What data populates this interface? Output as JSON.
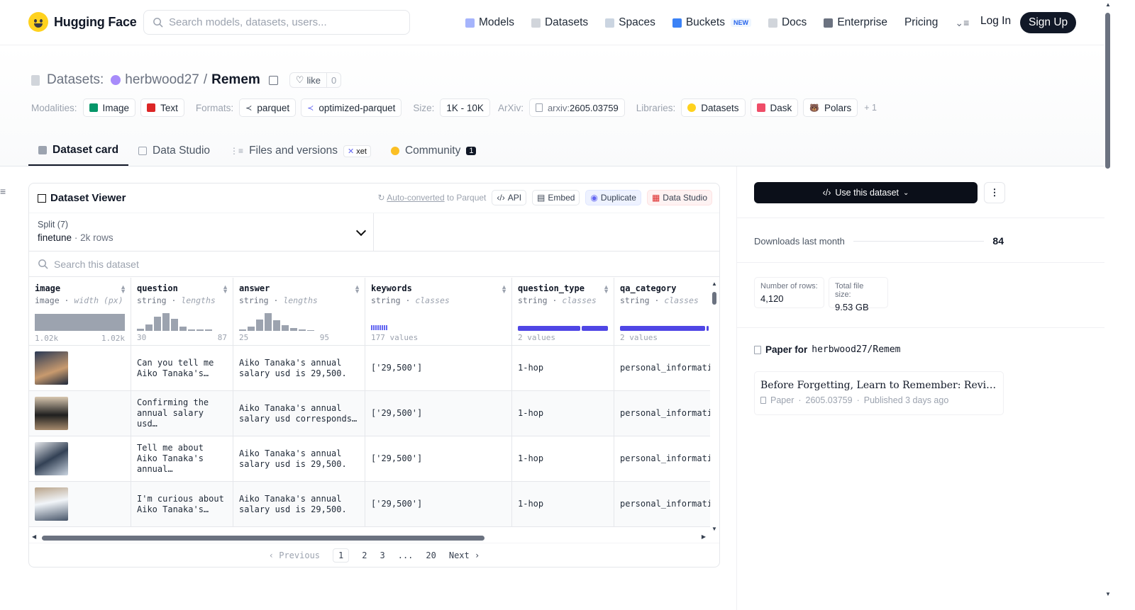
{
  "brand": {
    "name": "Hugging Face"
  },
  "search": {
    "placeholder": "Search models, datasets, users..."
  },
  "nav": {
    "items": [
      "Models",
      "Datasets",
      "Spaces",
      "Buckets",
      "Docs",
      "Enterprise",
      "Pricing"
    ],
    "new_badge": "NEW",
    "login": "Log In",
    "signup": "Sign Up"
  },
  "repo": {
    "type_label": "Datasets:",
    "owner": "herbwood27",
    "separator": "/",
    "name": "Remem",
    "like_label": "like",
    "like_count": "0"
  },
  "meta": {
    "modalities_label": "Modalities:",
    "modalities": [
      "Image",
      "Text"
    ],
    "formats_label": "Formats:",
    "formats": [
      "parquet",
      "optimized-parquet"
    ],
    "size_label": "Size:",
    "size": "1K - 10K",
    "arxiv_label": "ArXiv:",
    "arxiv_prefix": "arxiv:",
    "arxiv_id": "2605.03759",
    "libraries_label": "Libraries:",
    "libraries": [
      "Datasets",
      "Dask",
      "Polars"
    ],
    "libraries_more": "+ 1"
  },
  "tabs": [
    {
      "label": "Dataset card"
    },
    {
      "label": "Data Studio"
    },
    {
      "label": "Files and versions",
      "badge": "xet"
    },
    {
      "label": "Community",
      "badge": "1"
    }
  ],
  "viewer": {
    "title": "Dataset Viewer",
    "auto_converted": "Auto-converted",
    "auto_converted_suffix": "to Parquet",
    "actions": [
      "API",
      "Embed",
      "Duplicate",
      "Data Studio"
    ],
    "split_label": "Split (7)",
    "split_value": "finetune",
    "split_rows": "2k rows",
    "search_placeholder": "Search this dataset",
    "columns": [
      {
        "name": "image",
        "type": "image",
        "stat": "width (px)",
        "min": "1.02k",
        "max": "1.02k"
      },
      {
        "name": "question",
        "type": "string",
        "stat": "lengths",
        "min": "30",
        "max": "87"
      },
      {
        "name": "answer",
        "type": "string",
        "stat": "lengths",
        "min": "25",
        "max": "95"
      },
      {
        "name": "keywords",
        "type": "string",
        "stat": "classes",
        "summary": "177 values"
      },
      {
        "name": "question_type",
        "type": "string",
        "stat": "classes",
        "summary": "2 values"
      },
      {
        "name": "qa_category",
        "type": "string",
        "stat": "classes",
        "summary": "2 values"
      }
    ],
    "rows": [
      {
        "question": "Can you tell me Aiko Tanaka's…",
        "answer": "Aiko Tanaka's annual salary usd is 29,500.",
        "keywords": "['29,500']",
        "question_type": "1-hop",
        "qa_category": "personal_informati"
      },
      {
        "question": "Confirming the annual salary usd…",
        "answer": "Aiko Tanaka's annual salary usd corresponds…",
        "keywords": "['29,500']",
        "question_type": "1-hop",
        "qa_category": "personal_informati"
      },
      {
        "question": "Tell me about Aiko Tanaka's annual…",
        "answer": "Aiko Tanaka's annual salary usd is 29,500.",
        "keywords": "['29,500']",
        "question_type": "1-hop",
        "qa_category": "personal_informati"
      },
      {
        "question": "I'm curious about Aiko Tanaka's…",
        "answer": "Aiko Tanaka's annual salary usd is 29,500.",
        "keywords": "['29,500']",
        "question_type": "1-hop",
        "qa_category": "personal_informati"
      }
    ],
    "pager": {
      "prev": "‹ Previous",
      "pages": [
        "1",
        "2",
        "3",
        "...",
        "20"
      ],
      "next": "Next ›",
      "current": "1"
    }
  },
  "side": {
    "use_button": "Use this dataset",
    "downloads_label": "Downloads last month",
    "downloads": "84",
    "rows_label": "Number of rows:",
    "rows_value": "4,120",
    "filesize_label": "Total file size:",
    "filesize_value": "9.53 GB",
    "paper_for": "Paper for",
    "paper_repo": "herbwood27/Remem",
    "paper_title": "Before Forgetting, Learn to Remember: Revisiting …",
    "paper_kind": "Paper",
    "paper_id": "2605.03759",
    "paper_published": "Published 3 days ago"
  }
}
